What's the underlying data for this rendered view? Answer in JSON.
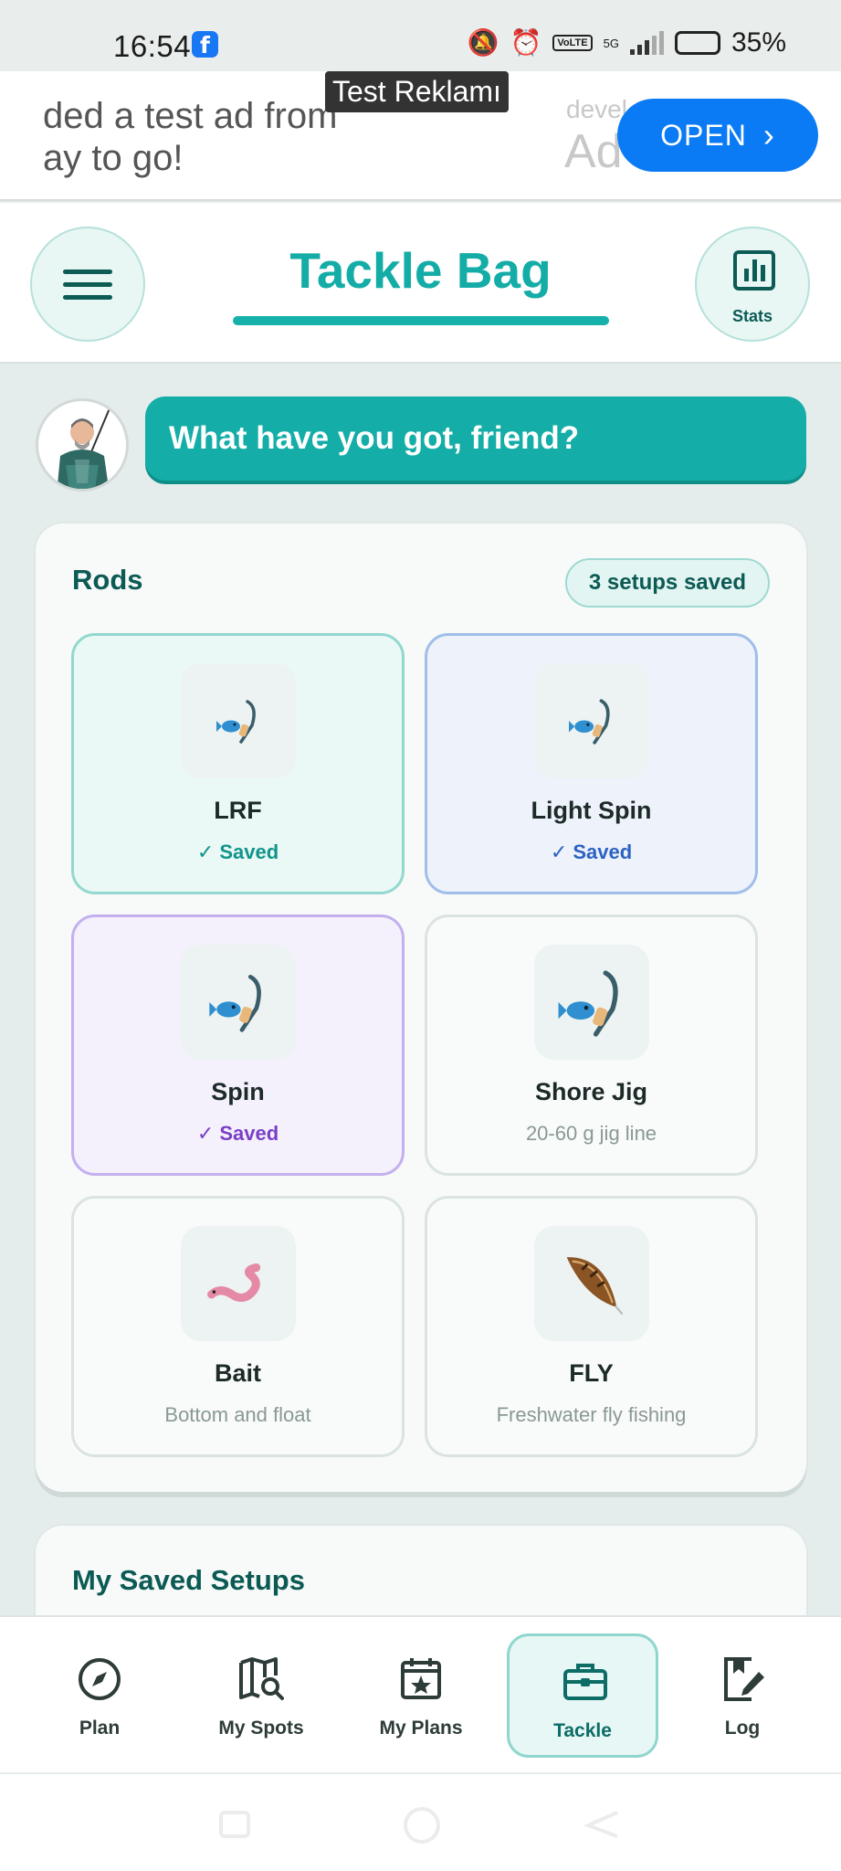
{
  "status_bar": {
    "time": "16:54",
    "network": "5G",
    "volte": "VoLTE",
    "battery": "35%"
  },
  "ad": {
    "tag": "Test Reklamı",
    "text_line1": "ded a test ad from",
    "text_line2": "ay to go!",
    "dev_text": "devel",
    "app_text": "Ad",
    "open_label": "OPEN"
  },
  "header": {
    "title": "Tackle Bag",
    "stats_label": "Stats"
  },
  "assistant": {
    "message": "What have you got, friend?"
  },
  "rods": {
    "title": "Rods",
    "badge": "3 setups saved",
    "items": [
      {
        "name": "LRF",
        "subtitle": "✓ Saved",
        "icon": "fishing-rod-icon"
      },
      {
        "name": "Light Spin",
        "subtitle": "✓ Saved",
        "icon": "fishing-rod-icon"
      },
      {
        "name": "Spin",
        "subtitle": "✓ Saved",
        "icon": "fishing-rod-icon"
      },
      {
        "name": "Shore Jig",
        "subtitle": "20-60 g jig line",
        "icon": "fishing-rod-icon"
      },
      {
        "name": "Bait",
        "subtitle": "Bottom and float",
        "icon": "worm-icon"
      },
      {
        "name": "FLY",
        "subtitle": "Freshwater fly fishing",
        "icon": "feather-icon"
      }
    ]
  },
  "saved_setups": {
    "title": "My Saved Setups"
  },
  "bottom_nav": {
    "items": [
      {
        "label": "Plan",
        "icon": "compass-icon"
      },
      {
        "label": "My Spots",
        "icon": "map-search-icon"
      },
      {
        "label": "My Plans",
        "icon": "calendar-star-icon"
      },
      {
        "label": "Tackle",
        "icon": "tackle-box-icon",
        "active": true
      },
      {
        "label": "Log",
        "icon": "logbook-icon"
      }
    ]
  },
  "colors": {
    "accent": "#14ada7",
    "dark_teal": "#0c5a54",
    "ad_button": "#0a7bf5"
  }
}
